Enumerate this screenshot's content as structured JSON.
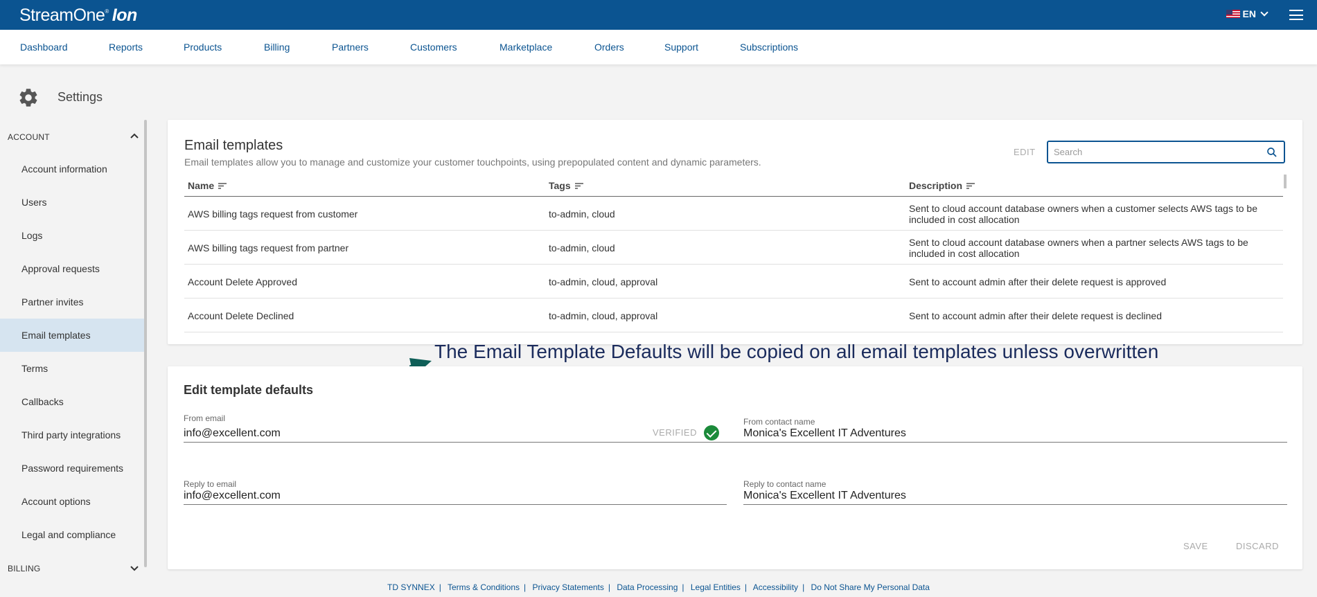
{
  "app": {
    "logo_main": "StreamOne",
    "logo_sub": "Ion",
    "language": "EN"
  },
  "nav": [
    "Dashboard",
    "Reports",
    "Products",
    "Billing",
    "Partners",
    "Customers",
    "Marketplace",
    "Orders",
    "Support",
    "Subscriptions"
  ],
  "settings": {
    "title": "Settings"
  },
  "sidebar": {
    "account_section": "ACCOUNT",
    "billing_section": "BILLING",
    "items": [
      "Account information",
      "Users",
      "Logs",
      "Approval requests",
      "Partner invites",
      "Email templates",
      "Terms",
      "Callbacks",
      "Third party integrations",
      "Password requirements",
      "Account options",
      "Legal and compliance"
    ],
    "active": "Email templates"
  },
  "email_templates": {
    "title": "Email templates",
    "subtitle": "Email templates allow you to manage and customize your customer touchpoints, using prepopulated content and dynamic parameters.",
    "edit_label": "EDIT",
    "search_placeholder": "Search",
    "columns": [
      "Name",
      "Tags",
      "Description"
    ],
    "rows": [
      {
        "name": "AWS billing tags request from customer",
        "tags": "to-admin, cloud",
        "description": "Sent to cloud account database owners when a customer selects AWS tags to be included in cost allocation"
      },
      {
        "name": "AWS billing tags request from partner",
        "tags": "to-admin, cloud",
        "description": "Sent to cloud account database owners when a partner selects AWS tags to be included in cost allocation"
      },
      {
        "name": "Account Delete Approved",
        "tags": "to-admin, cloud, approval",
        "description": "Sent to account admin after their delete request is approved"
      },
      {
        "name": "Account Delete Declined",
        "tags": "to-admin, cloud, approval",
        "description": "Sent to account admin after their delete request is declined"
      }
    ]
  },
  "annotation": "The Email Template Defaults will be copied on all email templates unless overwritten",
  "template_defaults": {
    "title": "Edit template defaults",
    "from_email_label": "From email",
    "from_email": "info@excellent.com",
    "verified_label": "VERIFIED",
    "from_contact_label": "From contact name",
    "from_contact": "Monica's Excellent IT Adventures",
    "reply_email_label": "Reply to email",
    "reply_email": "info@excellent.com",
    "reply_contact_label": "Reply to contact name",
    "reply_contact": "Monica's Excellent IT Adventures",
    "save_label": "SAVE",
    "discard_label": "DISCARD"
  },
  "footer": [
    "TD SYNNEX",
    "Terms & Conditions",
    "Privacy Statements",
    "Data Processing",
    "Legal Entities",
    "Accessibility",
    "Do Not Share My Personal Data"
  ]
}
